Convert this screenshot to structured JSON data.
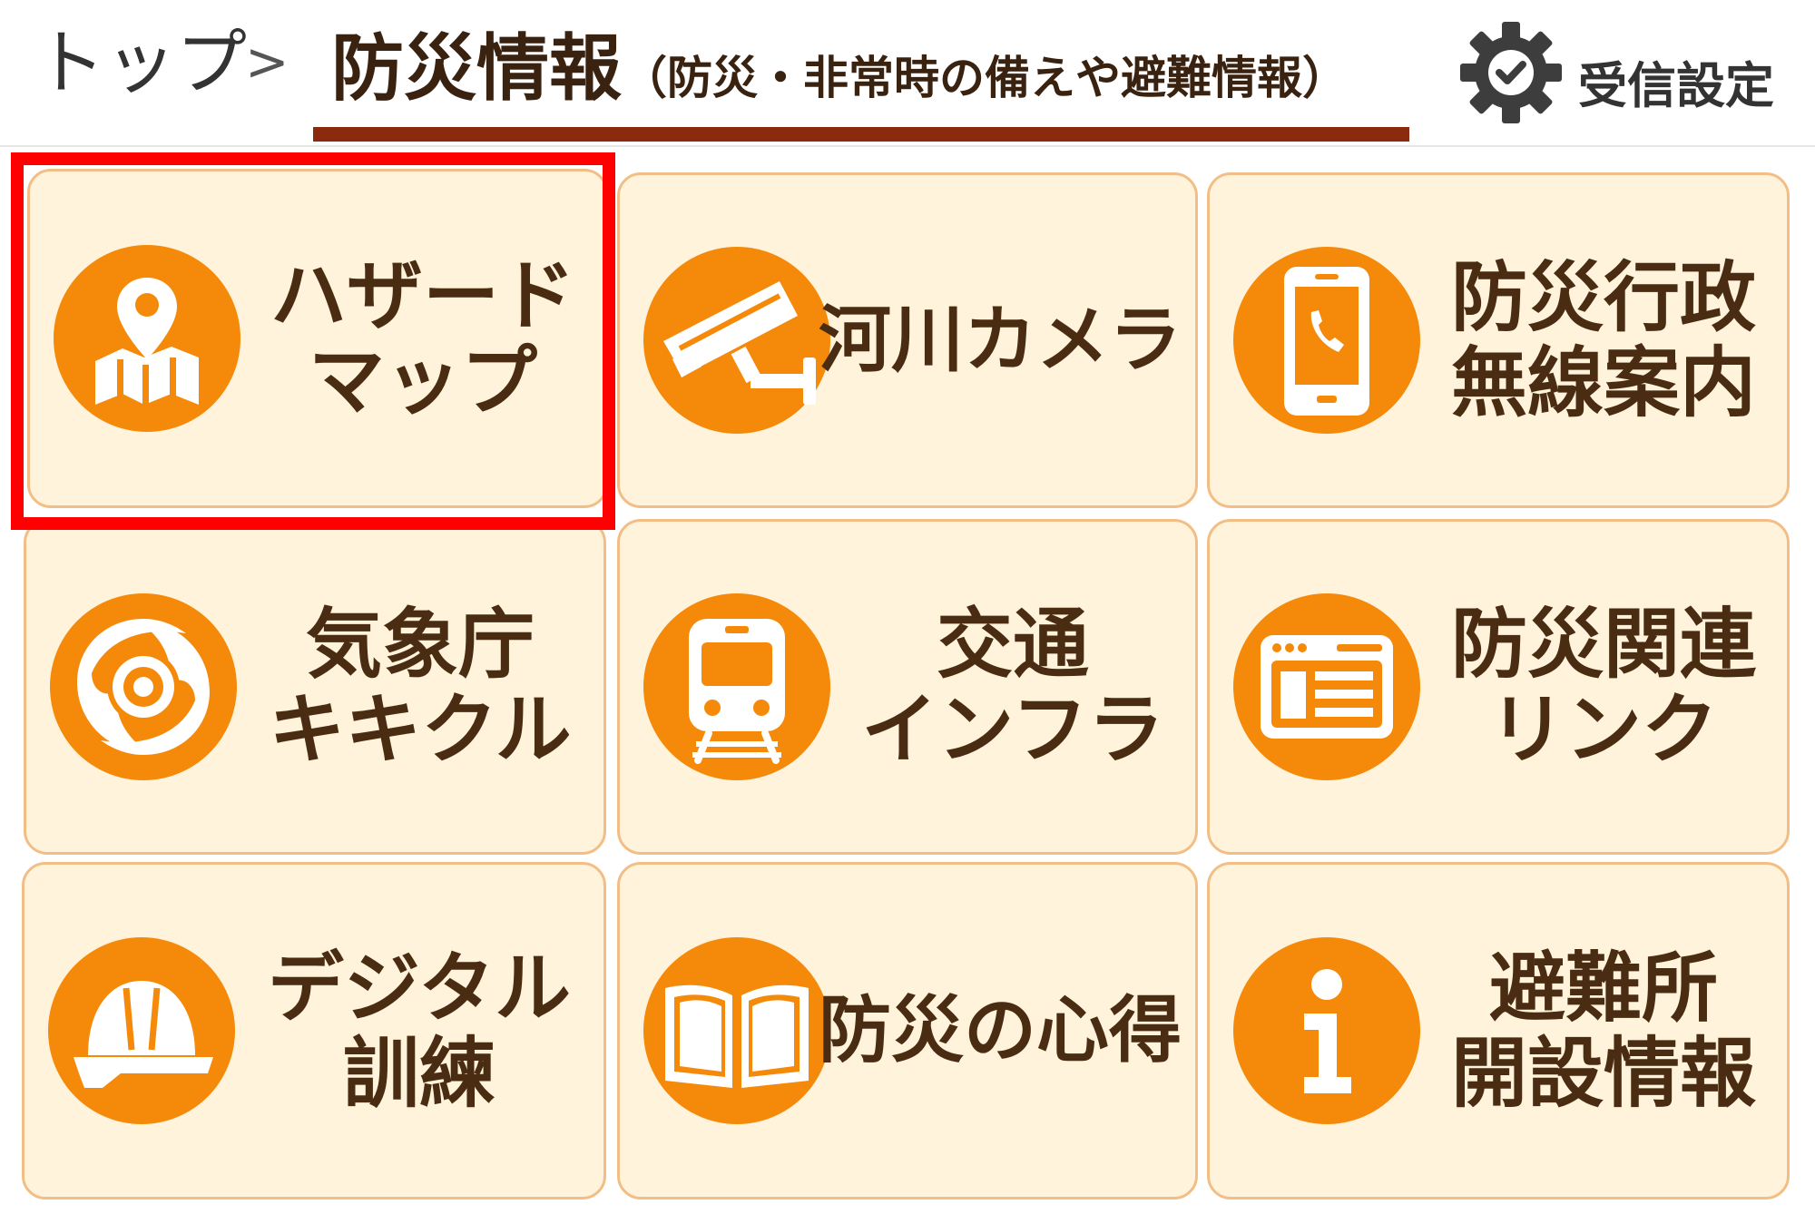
{
  "header": {
    "breadcrumb_top": "トップ",
    "breadcrumb_separator": ">",
    "title": "防災情報",
    "subtitle": "（防災・非常時の備えや避難情報）",
    "settings_label": "受信設定",
    "settings_icon": "gear-check-icon"
  },
  "colors": {
    "tile_bg": "#fff3dc",
    "tile_border": "#f3be86",
    "icon_bg": "#f58a0a",
    "label_text": "#4a2c12",
    "title_underline": "#8b2a0e",
    "selection": "#ff0000"
  },
  "tiles": [
    {
      "lines": [
        "ハザード",
        "マップ"
      ],
      "icon": "hazard-map-icon",
      "selected": true
    },
    {
      "lines": [
        "河川カメラ"
      ],
      "icon": "cctv-camera-icon",
      "selected": false
    },
    {
      "lines": [
        "防災行政",
        "無線案内"
      ],
      "icon": "smartphone-icon",
      "selected": false
    },
    {
      "lines": [
        "気象庁",
        "キキクル"
      ],
      "icon": "typhoon-icon",
      "selected": false
    },
    {
      "lines": [
        "交通",
        "インフラ"
      ],
      "icon": "train-icon",
      "selected": false
    },
    {
      "lines": [
        "防災関連",
        "リンク"
      ],
      "icon": "browser-window-icon",
      "selected": false
    },
    {
      "lines": [
        "デジタル",
        "訓練"
      ],
      "icon": "helmet-icon",
      "selected": false
    },
    {
      "lines": [
        "防災の心得"
      ],
      "icon": "open-book-icon",
      "selected": false
    },
    {
      "lines": [
        "避難所",
        "開設情報"
      ],
      "icon": "info-icon",
      "selected": false
    }
  ]
}
